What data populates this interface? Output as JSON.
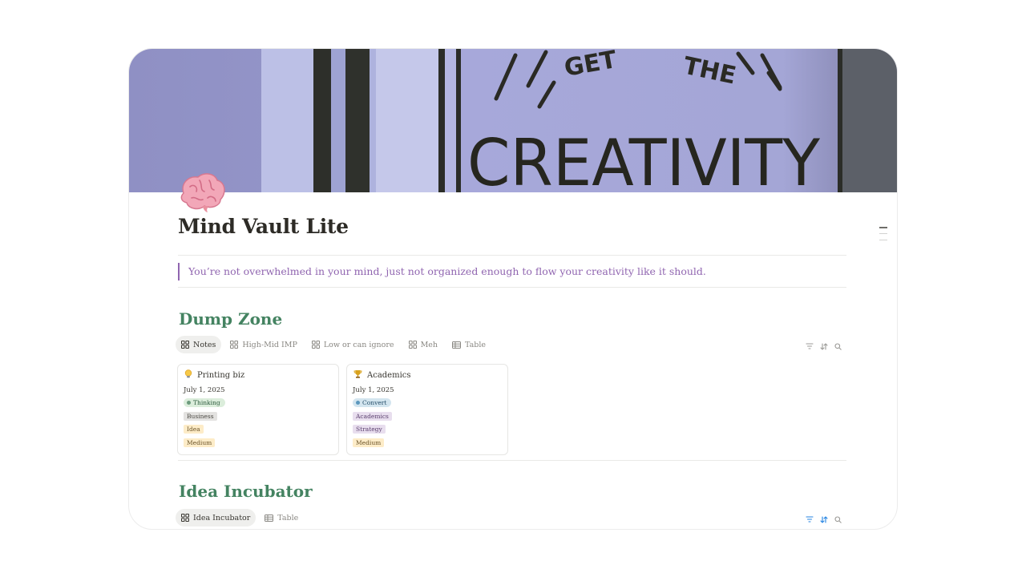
{
  "page": {
    "title": "Mind Vault Lite",
    "quote": "You’re not overwhelmed in your mind, just not organized enough to flow your creativity like it should."
  },
  "cover": {
    "text": "GET THE CREATIVITY"
  },
  "dump_zone": {
    "heading": "Dump Zone",
    "views": [
      {
        "label": "Notes"
      },
      {
        "label": "High-Mid IMP"
      },
      {
        "label": "Low or can ignore"
      },
      {
        "label": "Meh"
      },
      {
        "label": "Table"
      }
    ],
    "cards": [
      {
        "icon": "lightbulb-icon",
        "title": "Printing biz",
        "date": "July 1, 2025",
        "status": "Thinking",
        "tags": [
          "Business",
          "Idea",
          "Medium"
        ]
      },
      {
        "icon": "trophy-icon",
        "title": "Academics",
        "date": "July 1, 2025",
        "status": "Convert",
        "tags": [
          "Academics",
          "Strategy",
          "Medium"
        ]
      }
    ]
  },
  "idea_incubator": {
    "heading": "Idea Incubator",
    "views": [
      {
        "label": "Idea Incubator"
      },
      {
        "label": "Table"
      }
    ]
  },
  "colors": {
    "heading_green": "#448361",
    "quote_purple": "#9065b0",
    "thinking_bg": "#dbeddb",
    "convert_bg": "#d3e5ef",
    "medium_bg": "#fdecc8",
    "business_bg": "#e3e2e0",
    "purple_tag_bg": "#e8deee",
    "filter_active_blue": "#2383e2"
  }
}
